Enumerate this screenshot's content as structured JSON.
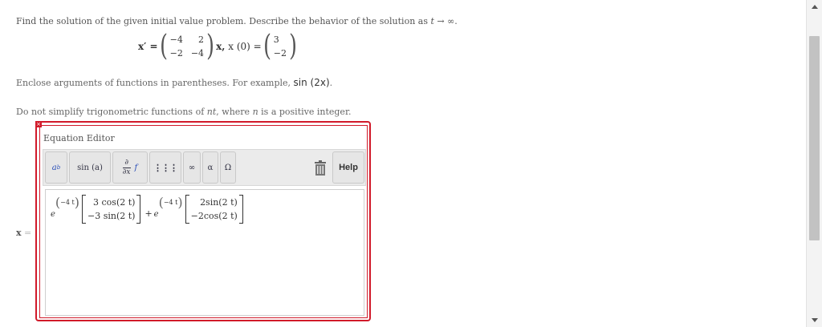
{
  "problem": {
    "prompt_text": "Find the solution of the given initial value problem. Describe the behavior of the solution as ",
    "t_symbol": "t",
    "arrow_inf": " → ∞.",
    "lhs": "x′ =",
    "matrix": [
      "−4",
      "2",
      "−2",
      "−4"
    ],
    "x_label": "x,",
    "ic_label": "x (0) =",
    "ic_vector": [
      "3",
      "−2"
    ]
  },
  "notes": {
    "enclose_prefix": "Enclose arguments of functions in parentheses. For example, ",
    "enclose_example": "sin (2x)",
    "enclose_suffix": ".",
    "trig_prefix": "Do not simplify trigonometric functions of ",
    "trig_nt": "nt",
    "trig_middle": ", where ",
    "trig_n": "n",
    "trig_suffix": " is a positive integer."
  },
  "editor": {
    "close_glyph": "×",
    "title": "Equation Editor",
    "toolbar": {
      "power": {
        "base": "a",
        "exp": "b"
      },
      "sin": "sin (a)",
      "deriv": {
        "num": "∂",
        "den": "∂x",
        "f": "f"
      },
      "matrix_glyph": "⋮⋮⋮",
      "infinity": "∞",
      "alpha": "α",
      "omega": "Ω",
      "help": "Help"
    },
    "answer": {
      "e1": "e",
      "exp1": "−4 t",
      "vec1": [
        "3 cos(2 t)",
        "−3 sin(2 t)"
      ],
      "plus": "+",
      "e2": "e",
      "exp2": "−4 t",
      "vec2": [
        "2sin(2 t)",
        "−2cos(2 t)"
      ]
    }
  },
  "answer_label": {
    "var": "x",
    "eq": " ="
  },
  "colors": {
    "frame_red": "#d11a2a",
    "toolbar_bg": "#ebebeb",
    "link_blue": "#2b4fb8"
  }
}
